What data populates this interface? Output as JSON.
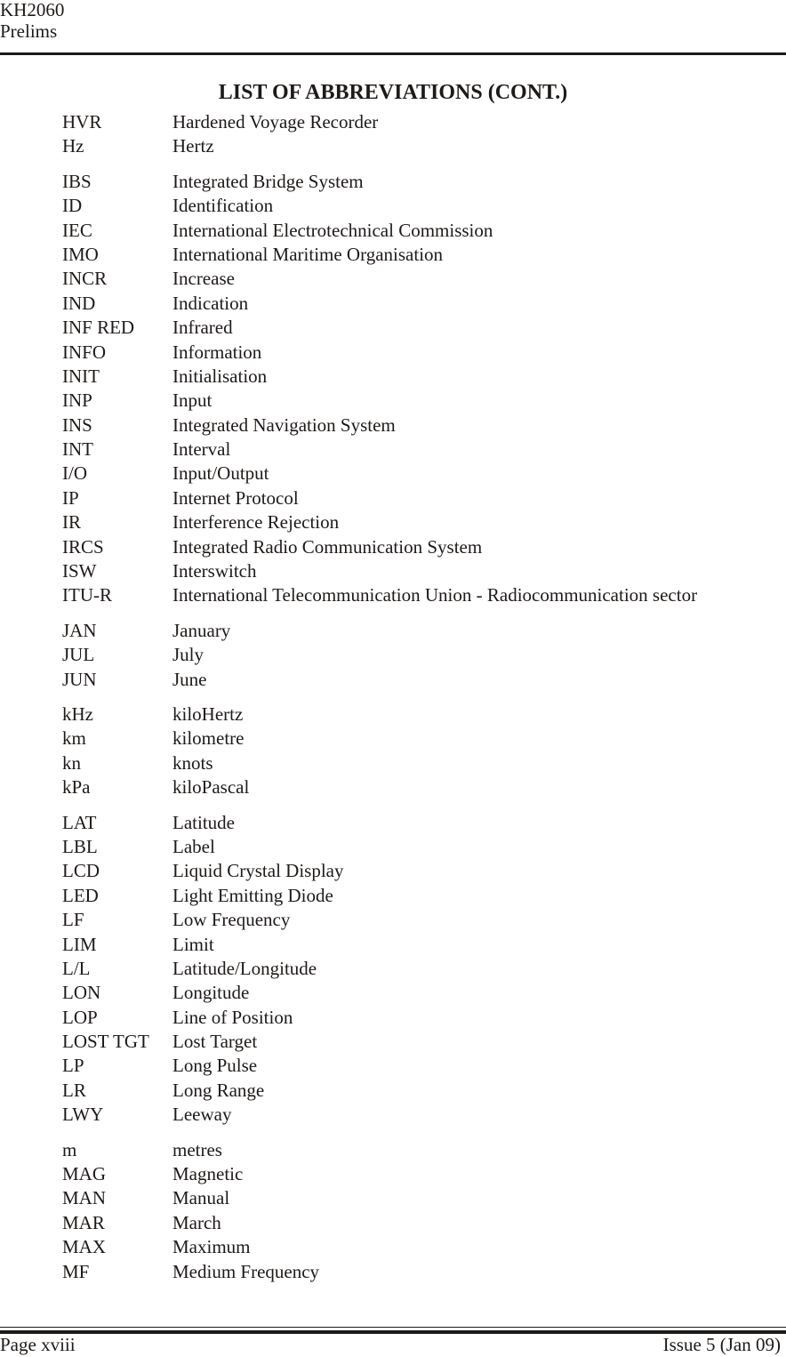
{
  "header": {
    "doc_code": "KH2060",
    "section": "Prelims"
  },
  "title": "LIST OF ABBREVIATIONS (CONT.)",
  "groups": [
    {
      "letter": "H",
      "entries": [
        {
          "abbr": "HVR",
          "def": "Hardened Voyage Recorder"
        },
        {
          "abbr": "Hz",
          "def": "Hertz"
        }
      ]
    },
    {
      "letter": "I",
      "entries": [
        {
          "abbr": "IBS",
          "def": "Integrated Bridge System"
        },
        {
          "abbr": "ID",
          "def": "Identification"
        },
        {
          "abbr": "IEC",
          "def": "International Electrotechnical Commission"
        },
        {
          "abbr": "IMO",
          "def": "International Maritime Organisation"
        },
        {
          "abbr": "INCR",
          "def": "Increase"
        },
        {
          "abbr": "IND",
          "def": "Indication"
        },
        {
          "abbr": "INF RED",
          "def": "Infrared"
        },
        {
          "abbr": "INFO",
          "def": "Information"
        },
        {
          "abbr": "INIT",
          "def": "Initialisation"
        },
        {
          "abbr": "INP",
          "def": "Input"
        },
        {
          "abbr": "INS",
          "def": "Integrated Navigation System"
        },
        {
          "abbr": "INT",
          "def": "Interval"
        },
        {
          "abbr": "I/O",
          "def": "Input/Output"
        },
        {
          "abbr": "IP",
          "def": "Internet Protocol"
        },
        {
          "abbr": "IR",
          "def": "Interference Rejection"
        },
        {
          "abbr": "IRCS",
          "def": "Integrated Radio Communication System"
        },
        {
          "abbr": "ISW",
          "def": "Interswitch"
        },
        {
          "abbr": "ITU-R",
          "def": "International Telecommunication Union - Radiocommunication sector"
        }
      ]
    },
    {
      "letter": "J",
      "entries": [
        {
          "abbr": "JAN",
          "def": "January"
        },
        {
          "abbr": "JUL",
          "def": "July"
        },
        {
          "abbr": "JUN",
          "def": "June"
        }
      ]
    },
    {
      "letter": "K",
      "entries": [
        {
          "abbr": "kHz",
          "def": "kiloHertz"
        },
        {
          "abbr": "km",
          "def": "kilometre"
        },
        {
          "abbr": "kn",
          "def": "knots"
        },
        {
          "abbr": "kPa",
          "def": "kiloPascal"
        }
      ]
    },
    {
      "letter": "L",
      "entries": [
        {
          "abbr": "LAT",
          "def": "Latitude"
        },
        {
          "abbr": "LBL",
          "def": "Label"
        },
        {
          "abbr": "LCD",
          "def": "Liquid Crystal Display"
        },
        {
          "abbr": "LED",
          "def": "Light Emitting Diode"
        },
        {
          "abbr": "LF",
          "def": "Low Frequency"
        },
        {
          "abbr": "LIM",
          "def": "Limit"
        },
        {
          "abbr": "L/L",
          "def": "Latitude/Longitude"
        },
        {
          "abbr": "LON",
          "def": "Longitude"
        },
        {
          "abbr": "LOP",
          "def": "Line of Position"
        },
        {
          "abbr": "LOST TGT",
          "def": "Lost Target"
        },
        {
          "abbr": "LP",
          "def": "Long Pulse"
        },
        {
          "abbr": "LR",
          "def": "Long Range"
        },
        {
          "abbr": "LWY",
          "def": "Leeway"
        }
      ]
    },
    {
      "letter": "M",
      "entries": [
        {
          "abbr": "m",
          "def": "metres"
        },
        {
          "abbr": "MAG",
          "def": "Magnetic"
        },
        {
          "abbr": "MAN",
          "def": "Manual"
        },
        {
          "abbr": "MAR",
          "def": "March"
        },
        {
          "abbr": "MAX",
          "def": "Maximum"
        },
        {
          "abbr": "MF",
          "def": "Medium Frequency"
        }
      ]
    }
  ],
  "footer": {
    "page": "Page xviii",
    "issue": "Issue 5 (Jan 09)"
  }
}
